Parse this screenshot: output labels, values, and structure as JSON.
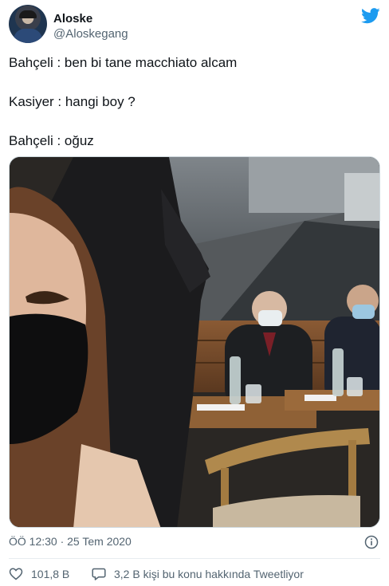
{
  "user": {
    "name": "Aloske",
    "handle": "@Aloskegang"
  },
  "tweet": {
    "lines": [
      "Bahçeli : ben bi tane macchiato alcam",
      "Kasiyer : hangi boy ?",
      "Bahçeli : oğuz"
    ],
    "timestamp": "ÖÖ 12:30 · 25 Tem 2020"
  },
  "actions": {
    "likes": "101,8 B",
    "conversation": "3,2 B kişi bu konu hakkında Tweetliyor"
  },
  "icons": {
    "brand": "twitter-bird-icon",
    "info": "info-icon",
    "like": "heart-icon",
    "reply": "speech-bubble-icon"
  },
  "colors": {
    "twitter_blue": "#1d9bf0",
    "secondary_text": "#536471",
    "primary_text": "#0f1419"
  }
}
